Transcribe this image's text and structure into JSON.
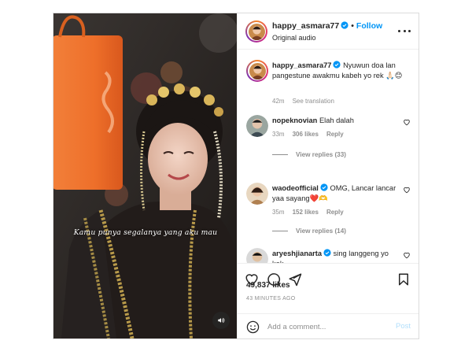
{
  "media": {
    "overlay_text": "Kamu punya segalanya yang aku mau",
    "audio_icon": "speaker-icon"
  },
  "header": {
    "username": "happy_asmara77",
    "follow_label": "Follow",
    "separator": "•",
    "subtitle": "Original audio"
  },
  "caption": {
    "username": "happy_asmara77",
    "text": "Nyuwun doa lan pangestune awakmu kabeh yo rek 🙏🏻😊",
    "age": "42m",
    "see_translation": "See translation"
  },
  "comments": [
    {
      "username": "nopeknovian",
      "text": "Elah dalah",
      "age": "33m",
      "likes": "306 likes",
      "reply_label": "Reply",
      "view_replies": "View replies (33)"
    },
    {
      "username": "waodeofficial",
      "text": "OMG, Lancar lancar yaa sayang❤️🫶",
      "age": "35m",
      "likes": "152 likes",
      "reply_label": "Reply",
      "view_replies": "View replies (14)"
    },
    {
      "username": "aryeshjianarta",
      "text": "sing langgeng yo kak",
      "age": "",
      "likes": "",
      "reply_label": "",
      "view_replies": ""
    }
  ],
  "stats": {
    "likes": "49,837 likes",
    "posted": "43 MINUTES AGO"
  },
  "composer": {
    "placeholder": "Add a comment...",
    "post_label": "Post"
  },
  "colors": {
    "accent": "#0095f6",
    "post_disabled": "#b2dffc",
    "verified": "#0095f6",
    "heart": "#ed4956"
  }
}
